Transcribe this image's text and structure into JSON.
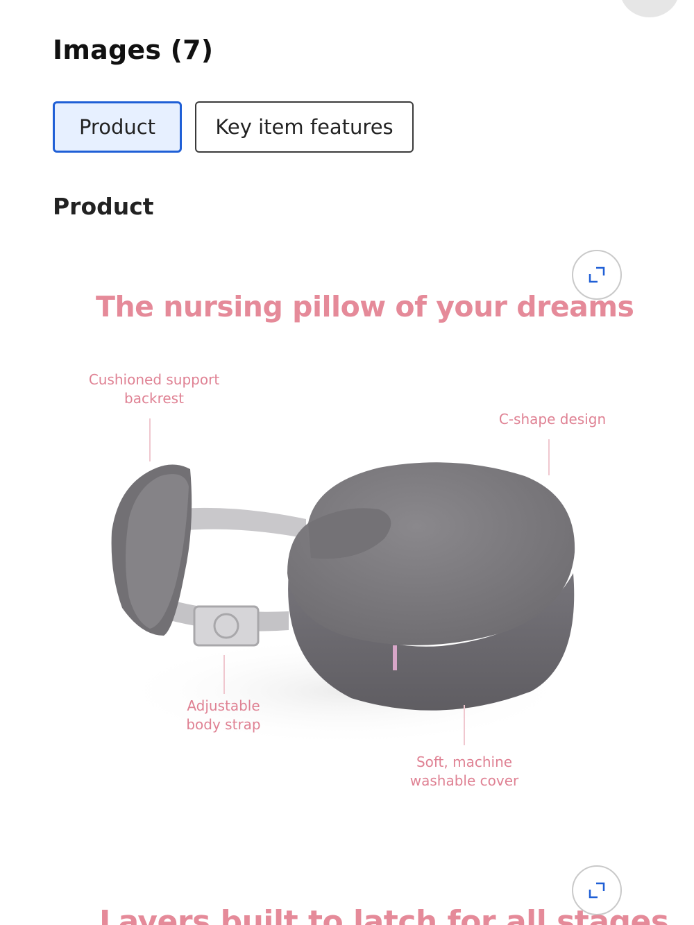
{
  "header": {
    "title": "Images (7)"
  },
  "tabs": [
    {
      "label": "Product",
      "active": true
    },
    {
      "label": "Key item features",
      "active": false
    }
  ],
  "section": {
    "title": "Product"
  },
  "images": [
    {
      "headline": "The nursing pillow of your dreams",
      "callouts": {
        "backrest": "Cushioned support\nbackrest",
        "c_shape": "C-shape design",
        "strap": "Adjustable\nbody strap",
        "cover": "Soft, machine\nwashable cover"
      },
      "expand_icon": "expand-icon"
    },
    {
      "headline": "Layers built to latch for all stages",
      "expand_icon": "expand-icon"
    }
  ],
  "colors": {
    "accent_blue": "#1f5fd6",
    "tab_active_bg": "#e7f0ff",
    "headline_pink": "#e58a99",
    "pillow_gray": "#7e7c80"
  }
}
